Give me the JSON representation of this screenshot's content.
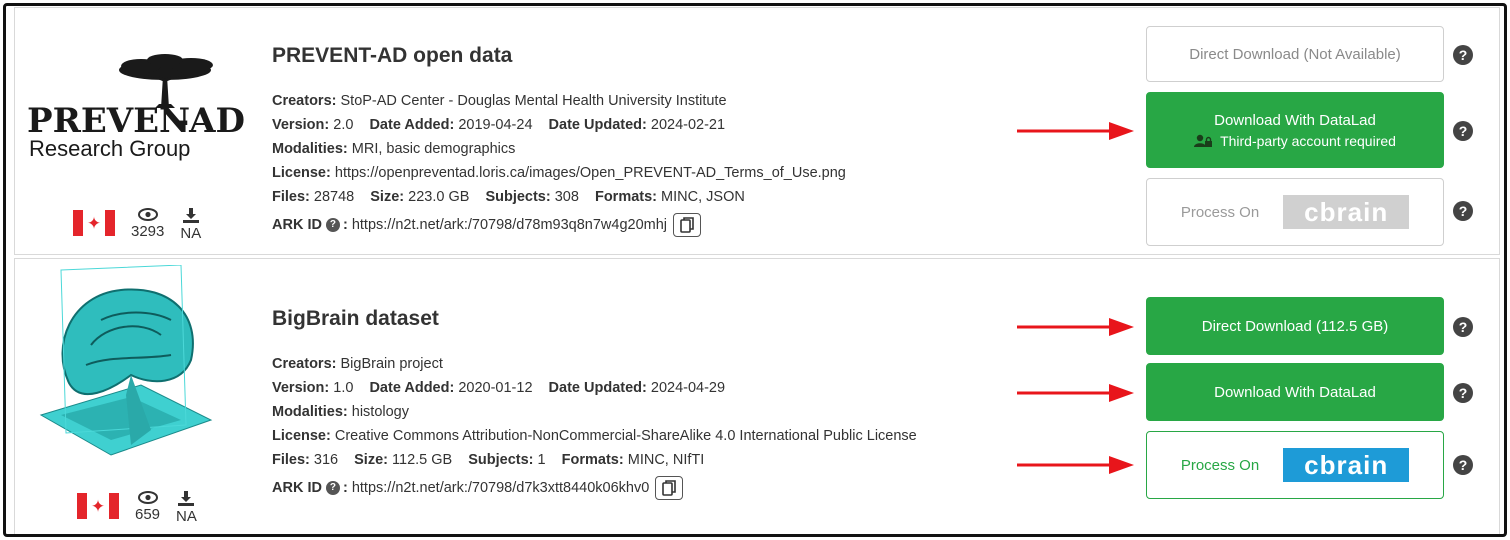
{
  "datasets": [
    {
      "title": "PREVENT-AD open data",
      "logo": {
        "line1": "PREVEN",
        "line1b": "-AD",
        "line2": "Research Group"
      },
      "country_flag": "canada-flag-icon",
      "views": "3293",
      "downloads": "NA",
      "labels": {
        "creators": "Creators:",
        "version": "Version:",
        "date_added": "Date Added:",
        "date_updated": "Date Updated:",
        "modalities": "Modalities:",
        "license": "License:",
        "files": "Files:",
        "size": "Size:",
        "subjects": "Subjects:",
        "formats": "Formats:",
        "ark": "ARK ID"
      },
      "creators": "StoP-AD Center - Douglas Mental Health University Institute",
      "version": "2.0",
      "date_added": "2019-04-24",
      "date_updated": "2024-02-21",
      "modalities": "MRI, basic demographics",
      "license": "https://openpreventad.loris.ca/images/Open_PREVENT-AD_Terms_of_Use.png",
      "files": "28748",
      "size": "223.0 GB",
      "subjects": "308",
      "formats": "MINC, JSON",
      "ark_id": "https://n2t.net/ark:/70798/d78m93q8n7w4g20mhj",
      "buttons": {
        "direct": "Direct Download (Not Available)",
        "datalad": "Download With DataLad",
        "datalad_sub": "Third-party account required",
        "process": "Process On",
        "cbrain": "cbrain"
      }
    },
    {
      "title": "BigBrain dataset",
      "country_flag": "canada-flag-icon",
      "views": "659",
      "downloads": "NA",
      "labels": {
        "creators": "Creators:",
        "version": "Version:",
        "date_added": "Date Added:",
        "date_updated": "Date Updated:",
        "modalities": "Modalities:",
        "license": "License:",
        "files": "Files:",
        "size": "Size:",
        "subjects": "Subjects:",
        "formats": "Formats:",
        "ark": "ARK ID"
      },
      "creators": "BigBrain project",
      "version": "1.0",
      "date_added": "2020-01-12",
      "date_updated": "2024-04-29",
      "modalities": "histology",
      "license": "Creative Commons Attribution-NonCommercial-ShareAlike 4.0 International Public License",
      "files": "316",
      "size": "112.5 GB",
      "subjects": "1",
      "formats": "MINC, NIfTI",
      "ark_id": "https://n2t.net/ark:/70798/d7k3xtt8440k06khv0",
      "buttons": {
        "direct": "Direct Download (112.5 GB)",
        "datalad": "Download With DataLad",
        "process": "Process On",
        "cbrain": "cbrain"
      }
    }
  ],
  "help_glyph": "?",
  "colors": {
    "green": "#28a745",
    "cbrain_blue": "#1e9bd7",
    "arrow_red": "#e8151b"
  }
}
